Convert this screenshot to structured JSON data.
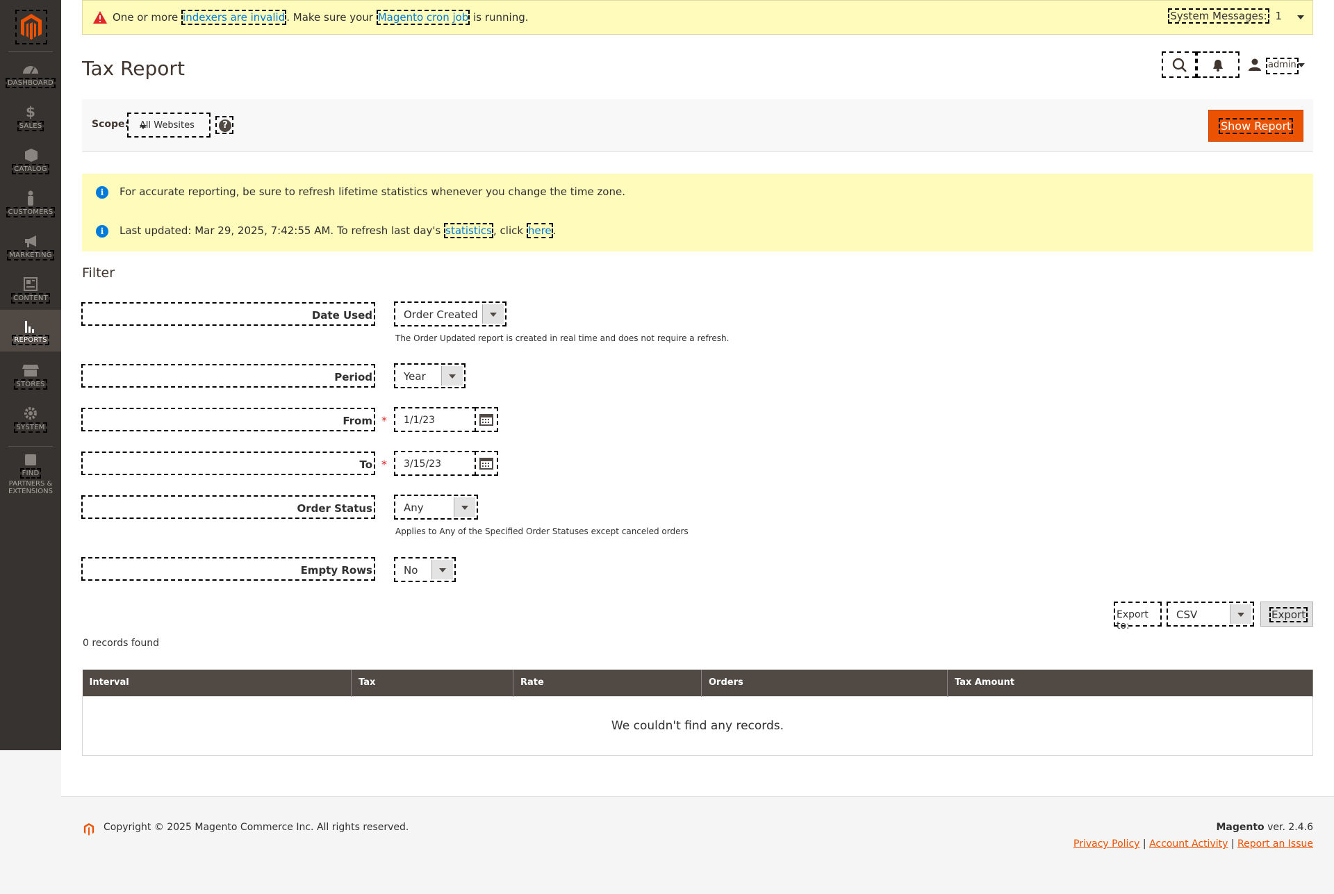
{
  "sidebar": {
    "items": [
      {
        "label": "DASHBOARD",
        "icon": "dashboard-icon"
      },
      {
        "label": "SALES",
        "icon": "dollar-icon"
      },
      {
        "label": "CATALOG",
        "icon": "cube-icon"
      },
      {
        "label": "CUSTOMERS",
        "icon": "person-icon"
      },
      {
        "label": "MARKETING",
        "icon": "megaphone-icon"
      },
      {
        "label": "CONTENT",
        "icon": "layout-icon"
      },
      {
        "label": "REPORTS",
        "icon": "bar-chart-icon"
      },
      {
        "label": "STORES",
        "icon": "store-icon"
      },
      {
        "label": "SYSTEM",
        "icon": "gear-icon"
      },
      {
        "label": "FIND",
        "extra1": "PARTNERS &",
        "extra2": "EXTENSIONS",
        "icon": "puzzle-icon"
      }
    ]
  },
  "system_message": {
    "prefix": "One or more ",
    "link1": "indexers are invalid",
    "middle": ". Make sure your ",
    "link2": "Magento cron job",
    "suffix": " is running.",
    "messages_label": "System Messages:",
    "messages_count": "1"
  },
  "header": {
    "title": "Tax Report",
    "user": "admin"
  },
  "scope": {
    "label": "Scope:",
    "value": "All Websites",
    "help": "?"
  },
  "actions": {
    "show_report": "Show Report"
  },
  "notices": {
    "line1": "For accurate reporting, be sure to refresh lifetime statistics whenever you change the time zone.",
    "line2_prefix": "Last updated: Mar 29, 2025, 7:42:55 AM. To refresh last day's ",
    "line2_link1": "statistics",
    "line2_middle": ", click ",
    "line2_link2": "here",
    "line2_suffix": "."
  },
  "filter": {
    "title": "Filter",
    "date_used": {
      "label": "Date Used",
      "value": "Order Created",
      "note": "The Order Updated report is created in real time and does not require a refresh."
    },
    "period": {
      "label": "Period",
      "value": "Year"
    },
    "from": {
      "label": "From",
      "value": "1/1/23"
    },
    "to": {
      "label": "To",
      "value": "3/15/23"
    },
    "order_status": {
      "label": "Order Status",
      "value": "Any",
      "note": "Applies to Any of the Specified Order Statuses except canceled orders"
    },
    "empty_rows": {
      "label": "Empty Rows",
      "value": "No"
    },
    "required_mark": "*"
  },
  "export": {
    "label": "Export to:",
    "format": "CSV",
    "button": "Export"
  },
  "grid": {
    "records": "0 records found",
    "columns": [
      "Interval",
      "Tax",
      "Rate",
      "Orders",
      "Tax Amount"
    ],
    "empty": "We couldn't find any records."
  },
  "footer": {
    "copyright": "Copyright © 2025 Magento Commerce Inc. All rights reserved.",
    "brand": "Magento",
    "version": " ver. 2.4.6",
    "links": [
      "Privacy Policy",
      "Account Activity",
      "Report an Issue"
    ],
    "separator": "|"
  },
  "colors": {
    "accent": "#eb5202",
    "sidebar": "#373330",
    "grid_header": "#514943",
    "notice_bg": "#fffbbb",
    "link": "#007bdb"
  }
}
